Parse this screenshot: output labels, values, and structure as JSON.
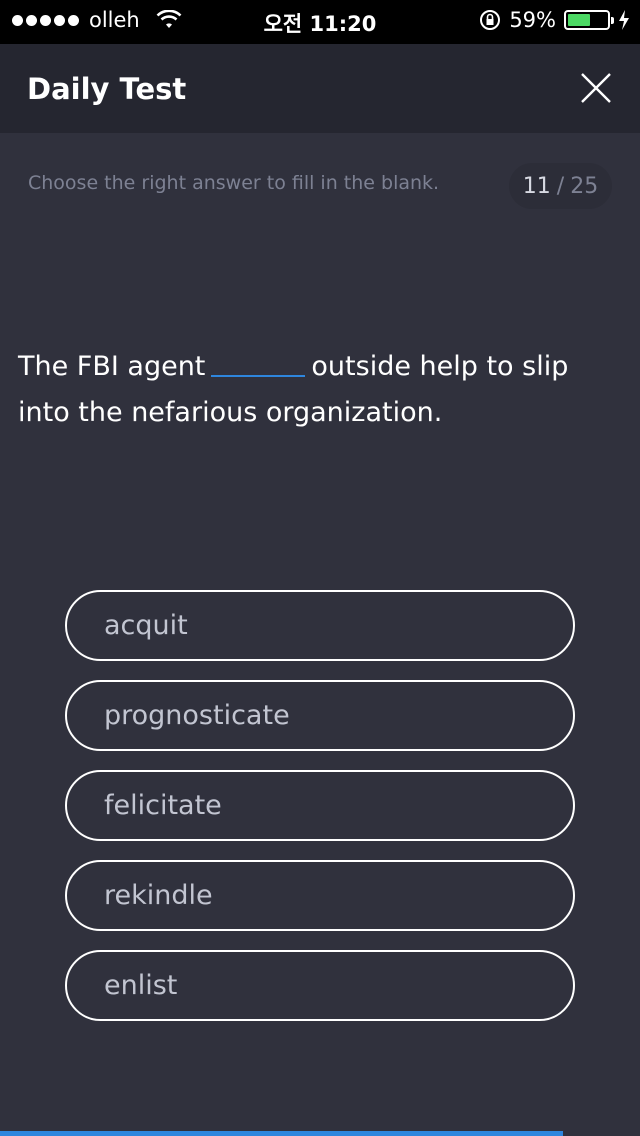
{
  "status_bar": {
    "carrier": "olleh",
    "time": "오전 11:20",
    "battery_percent": "59%",
    "battery_level": 0.59,
    "icons": [
      "signal-dots-icon",
      "wifi-icon",
      "orientation-lock-icon",
      "battery-icon",
      "charging-bolt-icon"
    ]
  },
  "header": {
    "title": "Daily Test",
    "close_icon": "close-icon"
  },
  "instruction": "Choose the right answer to fill in the blank.",
  "counter": {
    "current": "11",
    "separator": "/",
    "total": "25"
  },
  "question": {
    "before_blank": "The FBI agent",
    "after_blank": "outside help to slip into the nefarious organization."
  },
  "options": [
    "acquit",
    "prognosticate",
    "felicitate",
    "rekindle",
    "enlist"
  ],
  "progress": {
    "fraction": 0.88
  },
  "colors": {
    "background": "#30313d",
    "header": "#252630",
    "accent": "#2e86de",
    "battery": "#4cd964"
  }
}
